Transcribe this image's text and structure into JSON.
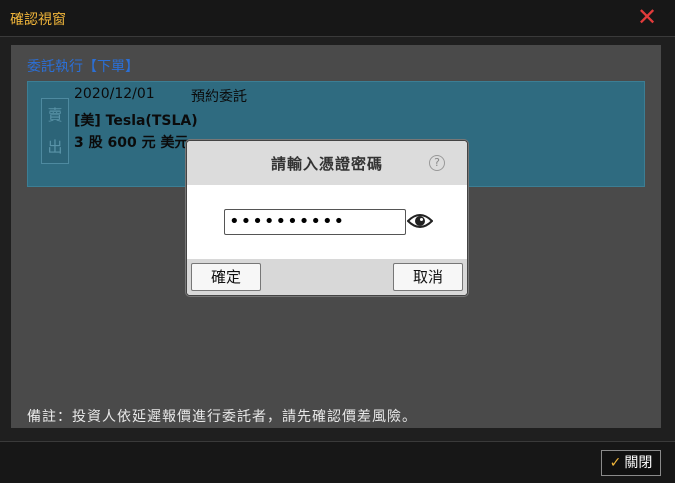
{
  "window": {
    "title": "確認視窗"
  },
  "section": {
    "title": "委託執行【下單】"
  },
  "order": {
    "side_chars": [
      "賣",
      "出"
    ],
    "date": "2020/12/01",
    "type": "預約委託",
    "stock": "[美] Tesla(TSLA)",
    "quantity": "3 股 600 元 美元"
  },
  "note": "備註：投資人依延遲報價進行委託者，請先確認價差風險。",
  "footer": {
    "close_label": "關閉",
    "check_glyph": "✓"
  },
  "modal": {
    "title": "請輸入憑證密碼",
    "help_glyph": "?",
    "password_value": "••••••••••",
    "ok_label": "確定",
    "cancel_label": "取消"
  },
  "icons": {
    "close": "close-icon",
    "help": "question-icon",
    "eye": "eye-icon",
    "check": "check-icon"
  },
  "colors": {
    "title_accent": "#f0b53a",
    "close_red": "#e23b3b",
    "section_blue": "#2b6fd6",
    "order_box": "#2f6b80"
  }
}
